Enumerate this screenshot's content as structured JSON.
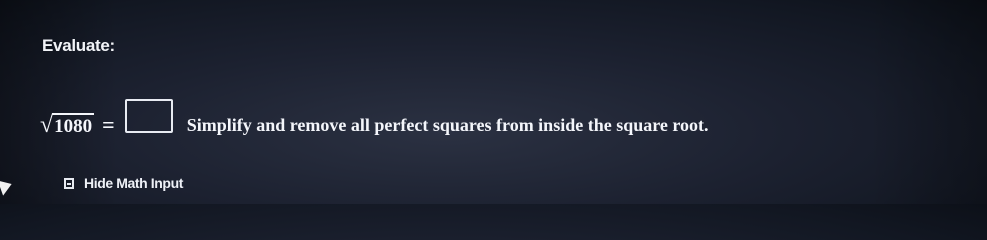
{
  "question": {
    "prompt": "Evaluate:",
    "radical_symbol": "√",
    "radicand": "1080",
    "equals": "=",
    "answer_value": "",
    "instruction": "Simplify and remove all perfect squares from inside the square root."
  },
  "math_input_toggle": {
    "label": "Hide Math Input",
    "icon": "keyboard-icon"
  },
  "colors": {
    "background": "#1c2130",
    "text": "#f4f6fb"
  }
}
